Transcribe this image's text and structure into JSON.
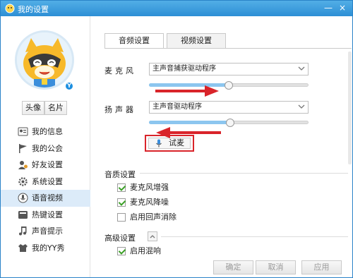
{
  "window": {
    "title": "我的设置",
    "min_symbol": "—",
    "close_symbol": "×"
  },
  "sidebar": {
    "avatar_badge": "Y",
    "avatar_buttons": [
      "头像",
      "名片"
    ],
    "items": [
      {
        "label": "我的信息",
        "icon": "person-card-icon",
        "active": false
      },
      {
        "label": "我的公会",
        "icon": "flag-icon",
        "active": false
      },
      {
        "label": "好友设置",
        "icon": "friend-settings-icon",
        "active": false
      },
      {
        "label": "系统设置",
        "icon": "gear-icon",
        "active": false
      },
      {
        "label": "语音视频",
        "icon": "microphone-icon",
        "active": true
      },
      {
        "label": "热键设置",
        "icon": "keyboard-icon",
        "active": false
      },
      {
        "label": "声音提示",
        "icon": "music-note-icon",
        "active": false
      },
      {
        "label": "我的YY秀",
        "icon": "outfit-icon",
        "active": false
      }
    ]
  },
  "tabs": [
    "音频设置",
    "视频设置"
  ],
  "audio": {
    "mic_label": "麦克风",
    "mic_device": "主声音捕获驱动程序",
    "mic_volume": 0.5,
    "speaker_label": "扬声器",
    "speaker_device": "主声音驱动程序",
    "speaker_volume": 0.51,
    "test_button": "试麦"
  },
  "quality": {
    "title": "音质设置",
    "options": [
      {
        "label": "麦克风增强",
        "checked": true
      },
      {
        "label": "麦克风降噪",
        "checked": true
      },
      {
        "label": "启用回声消除",
        "checked": false
      }
    ]
  },
  "advanced": {
    "title": "高级设置",
    "options": [
      {
        "label": "启用混响",
        "checked": true
      }
    ]
  },
  "footer": {
    "ok": "确定",
    "cancel": "取消",
    "apply": "应用"
  },
  "colors": {
    "titlebar": "#2d8fd5",
    "highlight": "#d9242a",
    "slider_fill": "#8cc6ef",
    "check": "#3b9f26"
  }
}
